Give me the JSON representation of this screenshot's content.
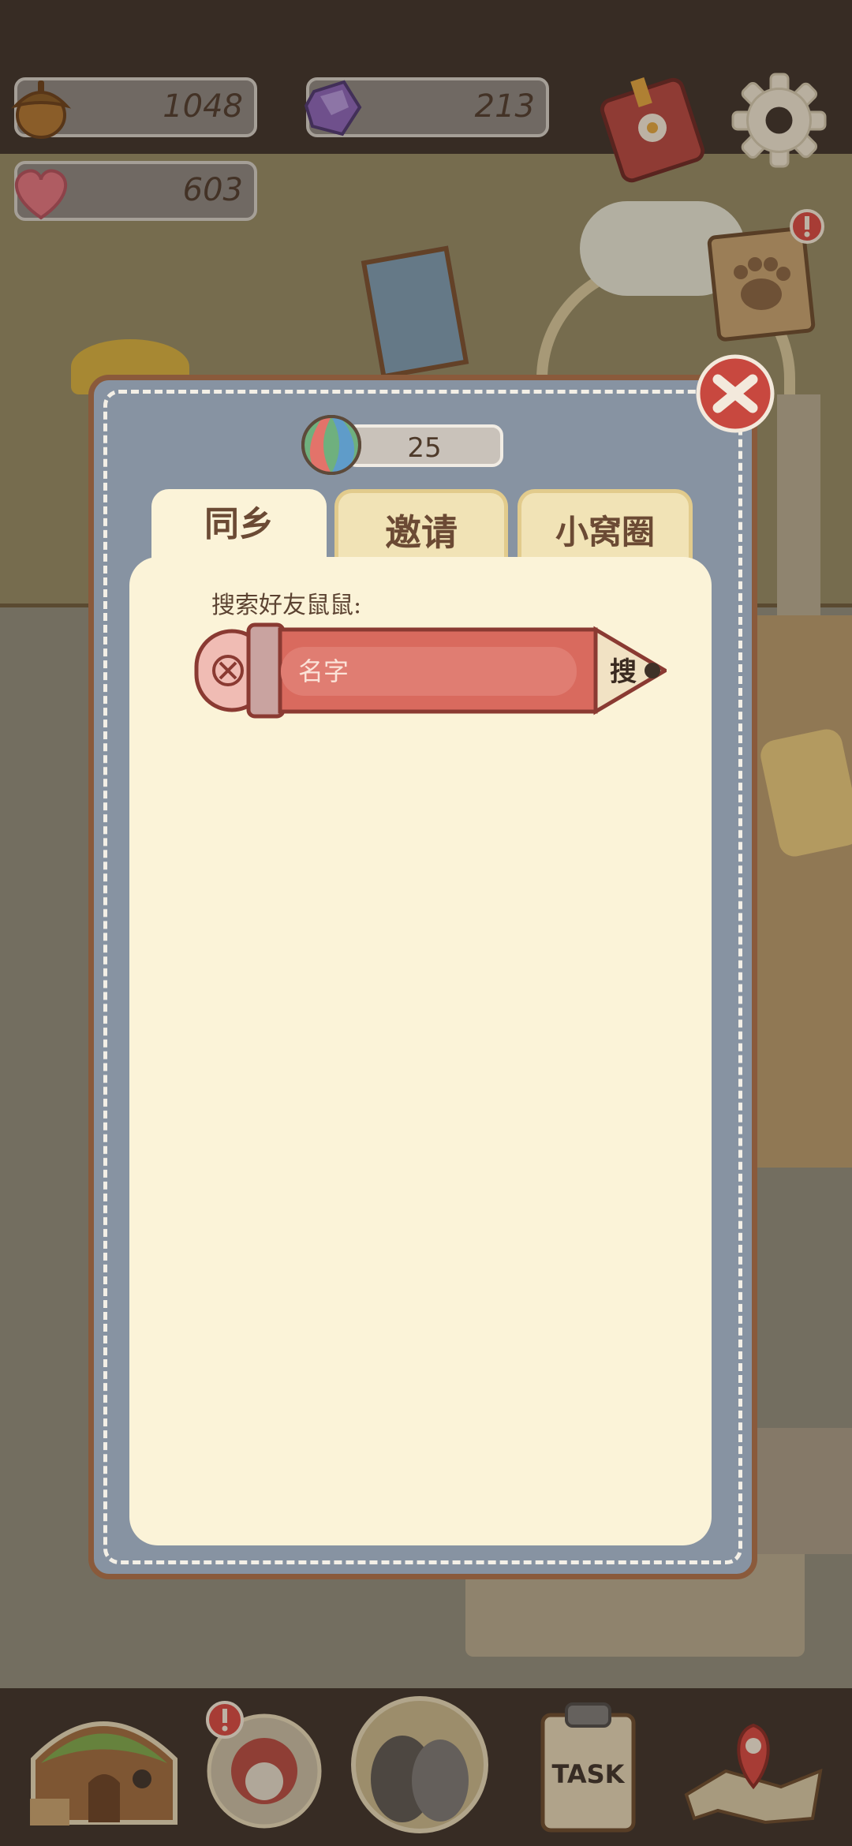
{
  "resources": {
    "acorns": "1048",
    "gems": "213",
    "hearts": "603"
  },
  "dialog": {
    "coins": "25",
    "tabs": [
      {
        "label": "同乡"
      },
      {
        "label": "邀请"
      },
      {
        "label": "小窝圈"
      }
    ],
    "search": {
      "label": "搜索好友鼠鼠:",
      "placeholder": "名字",
      "button": "搜"
    }
  },
  "bottom_nav": {
    "task_label": "TASK"
  }
}
